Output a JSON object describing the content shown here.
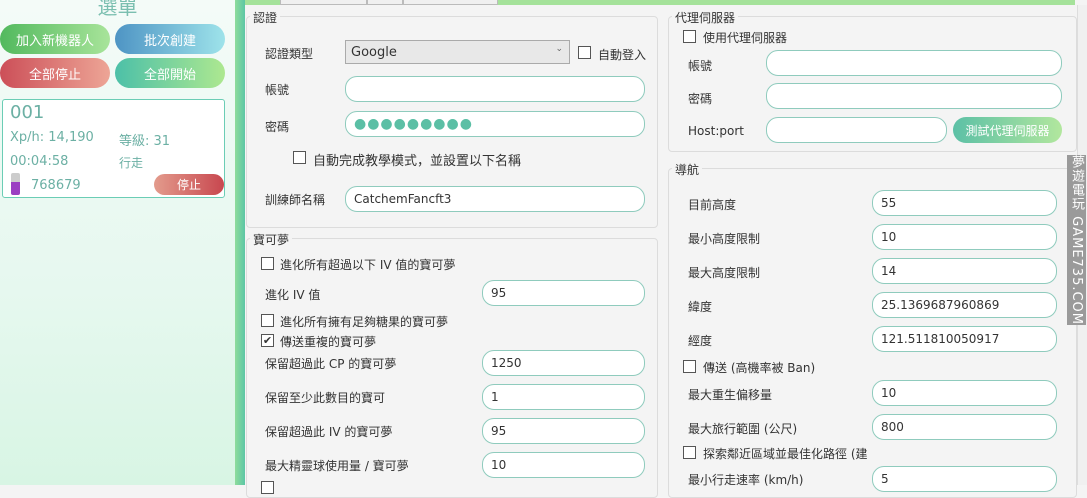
{
  "sidebar": {
    "title": "選單",
    "buttons": {
      "add_bot": "加入新機器人",
      "batch_create": "批次創建",
      "stop_all": "全部停止",
      "start_all": "全部開始"
    },
    "bot": {
      "name": "001",
      "xph": "Xp/h: 14,190",
      "level": "等級: 31",
      "time": "00:04:58",
      "status": "行走",
      "stardust": "768679",
      "stop": "停止"
    }
  },
  "auth": {
    "legend": "認證",
    "type_label": "認證類型",
    "type_value": "Google",
    "auto_login": "自動登入",
    "account_label": "帳號",
    "account_value": "",
    "password_label": "密碼",
    "password_value": "●●●●●●●●●",
    "tutorial": "自動完成教學模式，並設置以下名稱",
    "trainer_label": "訓練師名稱",
    "trainer_value": "CatchemFancft3"
  },
  "pokemon": {
    "legend": "寶可夢",
    "evolve_iv_check": "進化所有超過以下 IV 值的寶可夢",
    "evolve_iv_label": "進化 IV 值",
    "evolve_iv_value": "95",
    "evolve_candy_check": "進化所有擁有足夠糖果的寶可夢",
    "transfer_dupes_check": "傳送重複的寶可夢",
    "keep_cp_label": "保留超過此 CP 的寶可夢",
    "keep_cp_value": "1250",
    "keep_min_label": "保留至少此數目的寶可",
    "keep_min_value": "1",
    "keep_iv_label": "保留超過此 IV 的寶可夢",
    "keep_iv_value": "95",
    "max_balls_label": "最大精靈球使用量 / 寶可夢",
    "max_balls_value": "10"
  },
  "proxy": {
    "legend": "代理伺服器",
    "use_proxy": "使用代理伺服器",
    "account_label": "帳號",
    "password_label": "密碼",
    "host_label": "Host:port",
    "test_button": "測試代理伺服器"
  },
  "nav": {
    "legend": "導航",
    "rows": [
      {
        "label": "目前高度",
        "value": "55"
      },
      {
        "label": "最小高度限制",
        "value": "10"
      },
      {
        "label": "最大高度限制",
        "value": "14"
      },
      {
        "label": "緯度",
        "value": "25.1369687960869"
      },
      {
        "label": "經度",
        "value": "121.511810050917"
      }
    ],
    "teleport": "傳送 (高機率被 Ban)",
    "respawn_label": "最大重生偏移量",
    "respawn_value": "10",
    "range_label": "最大旅行範圍 (公尺)",
    "range_value": "800",
    "explore": "探索鄰近區域並最佳化路徑 (建",
    "walk_label": "最小行走速率 (km/h)",
    "walk_value": "5"
  },
  "watermark": "夢遊電玩 GAME735.COM"
}
